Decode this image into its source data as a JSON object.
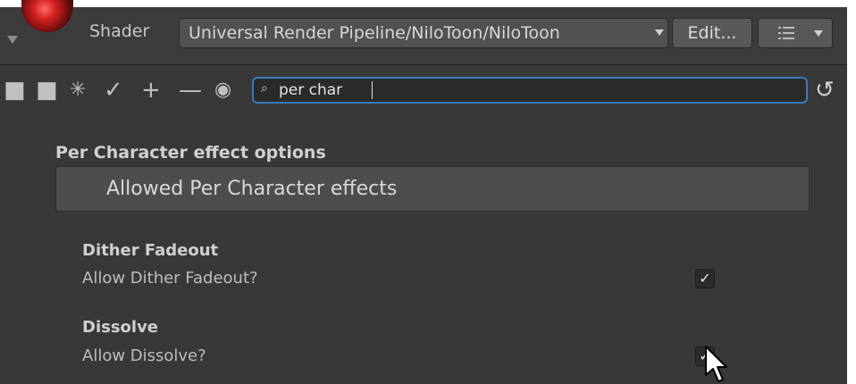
{
  "header": {
    "shader_label": "Shader",
    "shader_value": "Universal Render Pipeline/NiloToon/NiloToon",
    "edit_label": "Edit..."
  },
  "toolbar": {
    "search_icon_glyph": "⌕",
    "search_value": "per char",
    "tools": [
      {
        "name": "copy-icon",
        "glyph": "■"
      },
      {
        "name": "paste-icon",
        "glyph": "■"
      },
      {
        "name": "expand-icon",
        "glyph": "✳"
      },
      {
        "name": "check-icon",
        "glyph": "✓"
      },
      {
        "name": "plus-icon",
        "glyph": "+"
      },
      {
        "name": "minus-icon",
        "glyph": "—"
      },
      {
        "name": "eye-icon",
        "glyph": "◉"
      }
    ],
    "undo_glyph": "↺"
  },
  "content": {
    "section_title": "Per Character effect options",
    "group_header": "Allowed Per Character effects",
    "items": [
      {
        "title": "Dither Fadeout",
        "label": "Allow Dither Fadeout?",
        "checked": true
      },
      {
        "title": "Dissolve",
        "label": "Allow Dissolve?",
        "checked": true
      }
    ],
    "check_glyph": "✓"
  },
  "colors": {
    "accent": "#3a79bb",
    "background": "#383838"
  }
}
